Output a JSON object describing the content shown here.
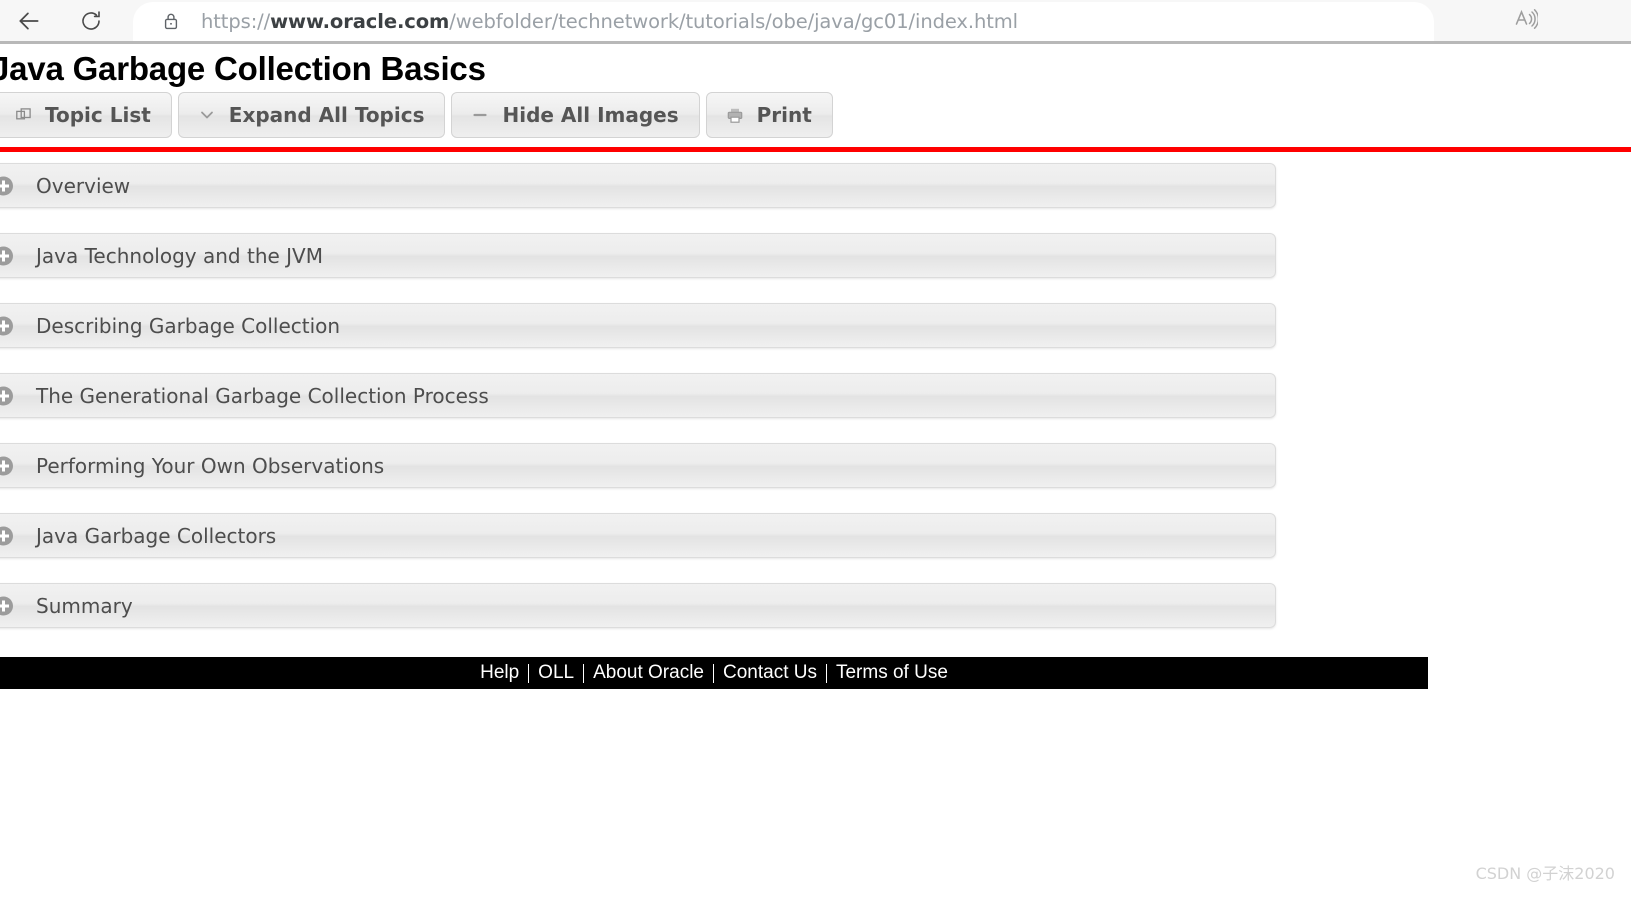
{
  "browser": {
    "back_label": "Back",
    "reload_label": "Reload",
    "lock_icon": "lock-icon",
    "read_aloud_icon": "read-aloud-icon",
    "url_prefix": "https://",
    "url_domain": "www.oracle.com",
    "url_path": "/webfolder/technetwork/tutorials/obe/java/gc01/index.html",
    "url_full": "https://www.oracle.com/webfolder/technetwork/tutorials/obe/java/gc01/index.html"
  },
  "page": {
    "title": "Java Garbage Collection Basics",
    "divider_color": "#ff0000"
  },
  "toolbar": {
    "buttons": [
      {
        "label": "Topic List",
        "icon": "windows-copy-icon"
      },
      {
        "label": "Expand All Topics",
        "icon": "chevron-down-icon"
      },
      {
        "label": "Hide All Images",
        "icon": "minus-icon"
      },
      {
        "label": "Print",
        "icon": "printer-icon"
      }
    ]
  },
  "accordion": {
    "expand_icon": "plus-circle-icon",
    "items": [
      {
        "label": "Overview"
      },
      {
        "label": "Java Technology and the JVM"
      },
      {
        "label": "Describing Garbage Collection"
      },
      {
        "label": "The Generational Garbage Collection Process"
      },
      {
        "label": "Performing Your Own Observations"
      },
      {
        "label": "Java Garbage Collectors"
      },
      {
        "label": "Summary"
      }
    ]
  },
  "footer": {
    "background_color": "#000000",
    "links": [
      {
        "label": "Help"
      },
      {
        "label": "OLL"
      },
      {
        "label": "About Oracle"
      },
      {
        "label": "Contact Us"
      },
      {
        "label": "Terms of Use"
      }
    ]
  },
  "watermark": {
    "text": "CSDN @子沫2020"
  }
}
